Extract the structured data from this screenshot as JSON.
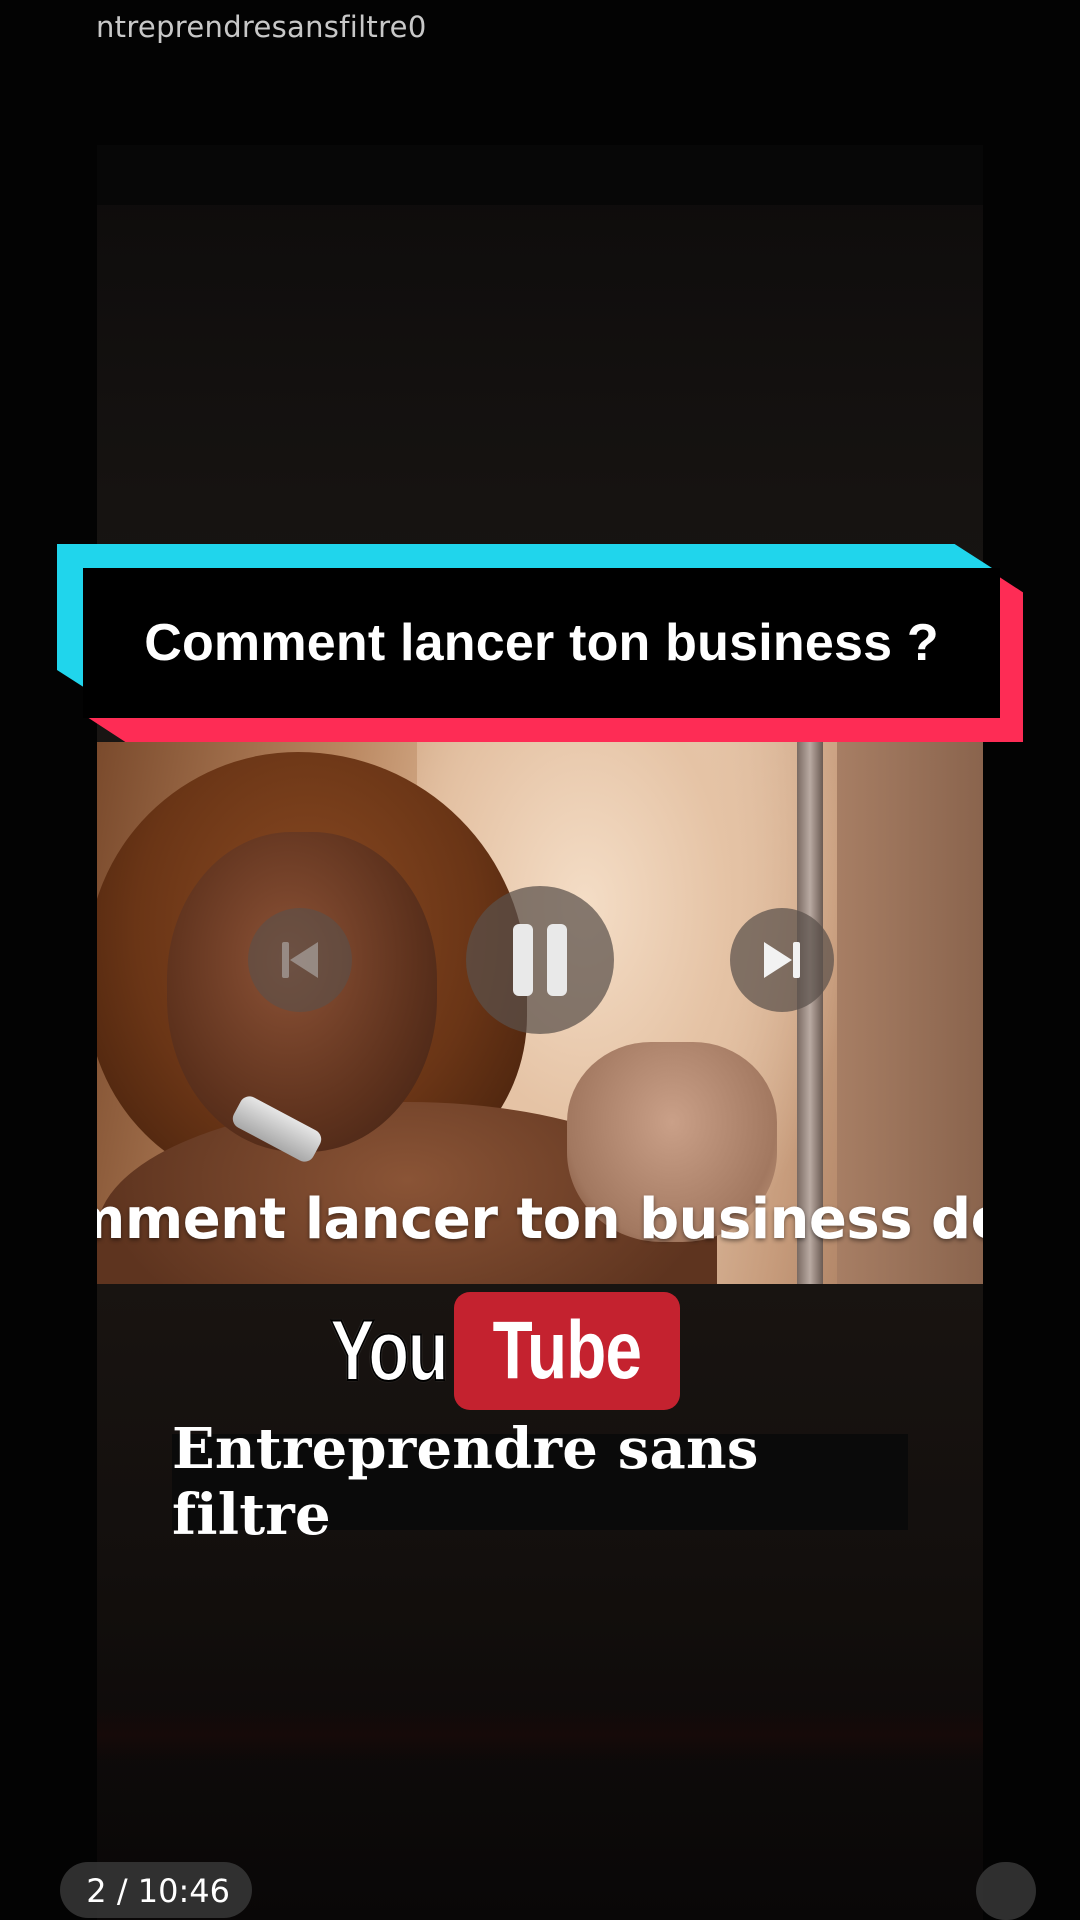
{
  "watermark": {
    "text": "ntreprendresansfiltre0"
  },
  "title_banner": {
    "text": "Comment lancer ton business ?"
  },
  "video": {
    "caption": "mment lancer ton business de A",
    "controls": {
      "previous_icon": "skip-previous-icon",
      "pause_icon": "pause-icon",
      "next_icon": "skip-next-icon"
    }
  },
  "logo": {
    "you": "You",
    "tube": "Tube"
  },
  "channel": {
    "name": "Entreprendre sans filtre"
  },
  "player": {
    "time": "2 / 10:46"
  },
  "colors": {
    "cyan": "#20d5ec",
    "red": "#fe2c55",
    "youtube_red": "#c4222f",
    "background": "#030303"
  }
}
